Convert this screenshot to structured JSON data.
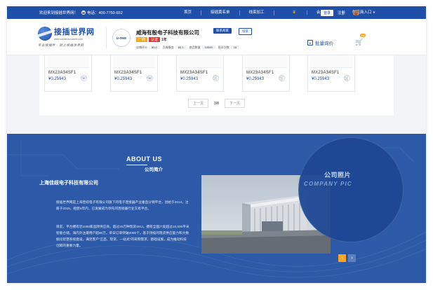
{
  "topbar": {
    "welcome": "欢迎来到接插世界网！",
    "phone": "电话：400-7750-652",
    "nav": [
      "首页",
      "接插黄名单",
      "线束加工"
    ],
    "vip": "会员",
    "supply": "供应商入口 ∨",
    "login": "登录",
    "register": "注册"
  },
  "logo": {
    "title": "接插世界网",
    "url": "www.connector-world.com",
    "slogan": "专业接插件 · 就上接插世界网"
  },
  "company": {
    "logo_text": "U-ONE",
    "name": "威海有殷电子科技有限公司",
    "contact_label": "联系商家",
    "complaint_label": "投诉",
    "badge_maker": "厂商",
    "badge_cert": "认证",
    "years": "1年",
    "stats": [
      {
        "label": "店铺评分",
        "value": "80.0"
      },
      {
        "label": "页端服务",
        "value": "60.1"
      },
      {
        "label": "商品数量",
        "value": "10000"
      },
      {
        "label": "投诉次数",
        "value": "10"
      }
    ],
    "inquiry_label": "批量询价",
    "cart_count": "24"
  },
  "products": [
    {
      "name": "MX23A34SF1",
      "price": "¥0.25943",
      "icon": "headset-icon",
      "glyph": "☏"
    },
    {
      "name": "MX23A34SF1",
      "price": "¥0.25943",
      "icon": "headset-icon",
      "glyph": "☏"
    },
    {
      "name": "MX23A34SF1",
      "price": "¥0.25943",
      "icon": "cart-icon",
      "glyph": "🛒"
    },
    {
      "name": "MX23A34SF1",
      "price": "¥0.25943",
      "icon": "cart-icon",
      "glyph": "🛒"
    },
    {
      "name": "MX23A34SF1",
      "price": "¥0.25943",
      "icon": "cart-icon",
      "glyph": "🛒"
    }
  ],
  "pager": {
    "prev": "上一页",
    "current": "3/8",
    "next": "下一页"
  },
  "about": {
    "title_en": "ABOUT US",
    "title_cn": "公司简介",
    "company": "上海佳歧电子科技有限公司",
    "p1": "接插世界网是上海佳歧电子有限公司旗下的电子连接器产业垂直分销平台，创始于2014，注册于2015，經歷6年内，已发展成为领先的连接器行业交易平台。",
    "p2": "目前，平台拥有近1000家品牌供应商，超过20万种现货SKU。拥有全国六处超过10,000平米智能仓储，海内外注册用户超80万，单日订单突破2000个。基于持续的现货供应能力和大数据化智慧系统建设，满足客户“正品、现货、一站式”的采购需求，基础设施，成为推动科技创新的重要力量。",
    "photo_title_cn": "公司照片",
    "photo_title_en": "COMPANY PIC"
  }
}
